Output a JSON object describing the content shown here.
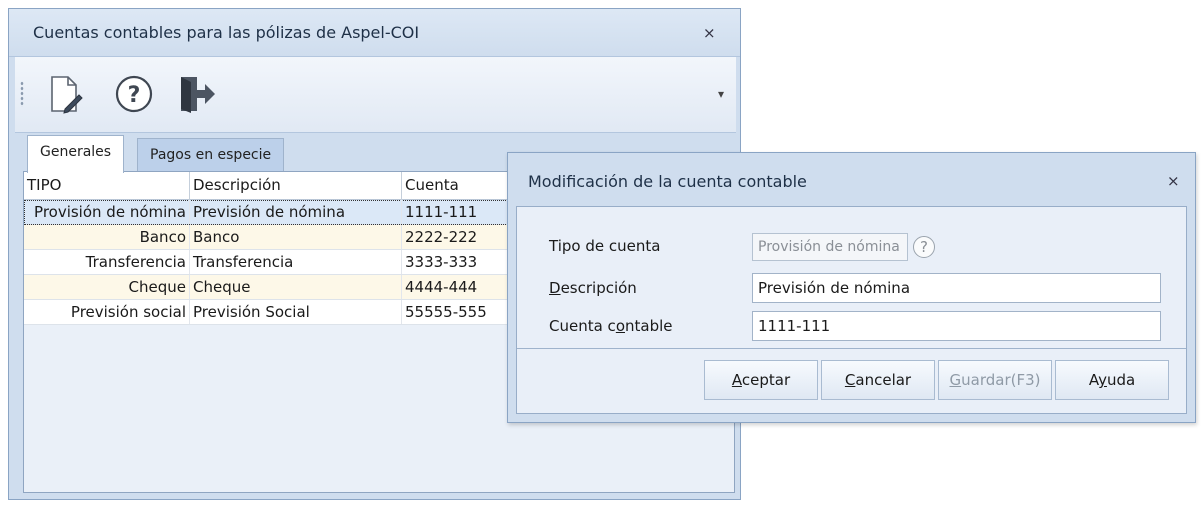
{
  "main_window": {
    "title": "Cuentas contables para las pólizas de Aspel-COI",
    "close_glyph": "⨯",
    "toolbar": {
      "icons": [
        "edit-document-icon",
        "help-icon",
        "exit-door-icon"
      ],
      "menu_glyph": "▾"
    },
    "tabs": [
      {
        "label": "Generales",
        "active": true
      },
      {
        "label": "Pagos en especie",
        "active": false
      }
    ],
    "grid": {
      "columns": [
        "TIPO",
        "Descripción",
        "Cuenta"
      ],
      "rows": [
        {
          "tipo": "Provisión de nómina",
          "descripcion": "Previsión de nómina",
          "cuenta": "1111-111"
        },
        {
          "tipo": "Banco",
          "descripcion": "Banco",
          "cuenta": "2222-222"
        },
        {
          "tipo": "Transferencia",
          "descripcion": "Transferencia",
          "cuenta": "3333-333"
        },
        {
          "tipo": "Cheque",
          "descripcion": "Cheque",
          "cuenta": "4444-444"
        },
        {
          "tipo": "Previsión social",
          "descripcion": "Previsión Social",
          "cuenta": "55555-555"
        }
      ]
    }
  },
  "dialog": {
    "title": "Modificación de la cuenta contable",
    "close_glyph": "⨯",
    "fields": {
      "tipo_label": "Tipo de cuenta",
      "tipo_value": "Provisión de nómina",
      "tipo_help": "?",
      "desc_label_u": "D",
      "desc_label_rest": "escripción",
      "desc_value": "Previsión de nómina",
      "cuenta_label_a": "Cuenta c",
      "cuenta_label_u": "o",
      "cuenta_label_b": "ntable",
      "cuenta_value": "1111-111"
    },
    "buttons": {
      "aceptar_u": "A",
      "aceptar_rest": "ceptar",
      "cancelar_u": "C",
      "cancelar_rest": "ancelar",
      "guardar_u": "G",
      "guardar_rest": "uardar(F3)",
      "ayuda_a": "A",
      "ayuda_u": "y",
      "ayuda_b": "uda"
    }
  },
  "colors": {
    "window_bg": "#cfddee",
    "row_alt": "#fdf8e8",
    "row_selected": "#dbe8f7"
  }
}
